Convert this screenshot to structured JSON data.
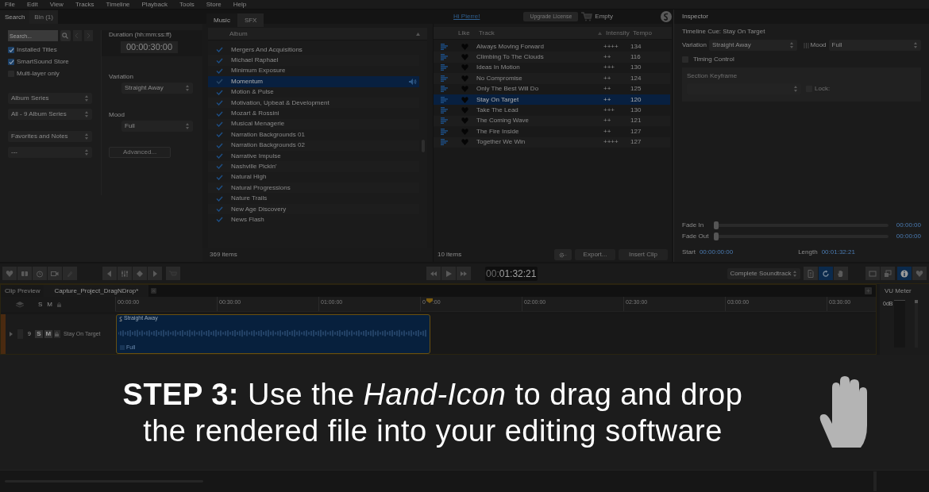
{
  "menu": [
    "File",
    "Edit",
    "View",
    "Tracks",
    "Timeline",
    "Playback",
    "Tools",
    "Store",
    "Help"
  ],
  "left_tabs": [
    {
      "label": "Search",
      "selected": true
    },
    {
      "label": "Bin (1)",
      "selected": false
    }
  ],
  "header": {
    "greeting": "Hi Pierre!",
    "upgrade_button": "Upgrade License",
    "cart": "Empty"
  },
  "search": {
    "placeholder": "Search...",
    "filters": [
      {
        "label": "Installed Titles",
        "checked": true
      },
      {
        "label": "SmartSound Store",
        "checked": true
      },
      {
        "label": "Multi-layer only",
        "checked": false
      }
    ],
    "selects": [
      "Album Series",
      "All - 9 Album Series",
      "Favorites and Notes",
      "---"
    ]
  },
  "duration": {
    "label": "Duration (hh:mm:ss:ff)",
    "value": "00:00:30:00"
  },
  "variation": {
    "label": "Variation",
    "value": "Straight Away"
  },
  "mood": {
    "label": "Mood",
    "value": "Full"
  },
  "advanced_button": "Advanced...",
  "library_tabs": [
    {
      "label": "Music",
      "selected": true
    },
    {
      "label": "SFX",
      "selected": false
    }
  ],
  "albums": {
    "column": "Album",
    "rows": [
      {
        "name": "Mergers And Acquisitions",
        "selected": false
      },
      {
        "name": "Michael Raphael",
        "selected": false
      },
      {
        "name": "Minimum Exposure",
        "selected": false
      },
      {
        "name": "Momentum",
        "selected": true
      },
      {
        "name": "Motion & Pulse",
        "selected": false
      },
      {
        "name": "Motivation, Upbeat & Development",
        "selected": false
      },
      {
        "name": "Mozart & Rossini",
        "selected": false
      },
      {
        "name": "Musical Menagerie",
        "selected": false
      },
      {
        "name": "Narration Backgrounds 01",
        "selected": false
      },
      {
        "name": "Narration Backgrounds 02",
        "selected": false
      },
      {
        "name": "Narrative Impulse",
        "selected": false
      },
      {
        "name": "Nashville Pickin'",
        "selected": false
      },
      {
        "name": "Natural High",
        "selected": false
      },
      {
        "name": "Natural Progressions",
        "selected": false
      },
      {
        "name": "Nature Trails",
        "selected": false
      },
      {
        "name": "New Age Discovery",
        "selected": false
      },
      {
        "name": "News Flash",
        "selected": false
      }
    ],
    "count": "369 items"
  },
  "tracks": {
    "columns": [
      "Like",
      "Track",
      "Intensity",
      "Tempo"
    ],
    "rows": [
      {
        "title": "Always Moving Forward",
        "intensity": "++++",
        "tempo": "134",
        "selected": false
      },
      {
        "title": "Climbing To The Clouds",
        "intensity": "++",
        "tempo": "116",
        "selected": false
      },
      {
        "title": "Ideas In Motion",
        "intensity": "+++",
        "tempo": "130",
        "selected": false
      },
      {
        "title": "No Compromise",
        "intensity": "++",
        "tempo": "124",
        "selected": false
      },
      {
        "title": "Only The Best Will Do",
        "intensity": "++",
        "tempo": "125",
        "selected": false
      },
      {
        "title": "Stay On Target",
        "intensity": "++",
        "tempo": "120",
        "selected": true
      },
      {
        "title": "Take The Lead",
        "intensity": "+++",
        "tempo": "130",
        "selected": false
      },
      {
        "title": "The Coming Wave",
        "intensity": "++",
        "tempo": "121",
        "selected": false
      },
      {
        "title": "The Fire Inside",
        "intensity": "++",
        "tempo": "127",
        "selected": false
      },
      {
        "title": "Together We Win",
        "intensity": "++++",
        "tempo": "127",
        "selected": false
      }
    ],
    "count": "10 items",
    "export_button": "Export...",
    "insert_button": "Insert Clip"
  },
  "inspector": {
    "title": "Inspector",
    "cue": "Timeline Cue: Stay On Target",
    "variation_label": "Variation",
    "variation": "Straight Away",
    "mood_label": "Mood",
    "mood": "Full",
    "timing_control": {
      "label": "Timing Control",
      "checked": false
    },
    "section_keyframe": "Section Keyframe",
    "lock": {
      "label": "Lock:",
      "checked": false
    },
    "fades": [
      {
        "label": "Fade In",
        "level": 0,
        "value": "00:00:00"
      },
      {
        "label": "Fade Out",
        "level": 0,
        "value": "00:00:00"
      }
    ],
    "start_label": "Start",
    "start": "00:00:00:00",
    "length_label": "Length",
    "length": "00:01:32:21"
  },
  "transport": {
    "time_dim": "00:",
    "time": "01:32:21",
    "output": "Complete Soundtrack"
  },
  "export_tools": [
    {
      "kind": "file",
      "selected": false
    },
    {
      "kind": "refresh",
      "selected": true
    },
    {
      "kind": "hand",
      "selected": false
    }
  ],
  "view_tools": [
    {
      "kind": "panel",
      "selected": false
    },
    {
      "kind": "layers",
      "selected": false
    },
    {
      "kind": "info",
      "selected": true
    },
    {
      "kind": "heart",
      "selected": false
    }
  ],
  "timeline": {
    "tabs": [
      {
        "label": "Clip Preview",
        "selected": false
      },
      {
        "label": "Capture_Project_DragNDrop*",
        "selected": true
      }
    ],
    "header_solo": "S",
    "header_mute": "M",
    "ruler": [
      "00:00:00",
      "00:30:00",
      "01:00:00",
      {
        "before": "0",
        "after": ":00"
      },
      "02:00:00",
      "02:30:00",
      "03:00:00",
      "03:30:00"
    ],
    "track": {
      "number": "9",
      "solo": "S",
      "mute": "M",
      "name": "Stay On Target"
    },
    "clip": {
      "title": "Straight Away",
      "mood": "Full"
    }
  },
  "vu_meter": {
    "title": "VU Meter",
    "scale": "0dB"
  },
  "banner": {
    "line1": "**STEP 3:** Use the *Hand-Icon* to drag and drop",
    "line2": "the rendered file into your editing software"
  }
}
